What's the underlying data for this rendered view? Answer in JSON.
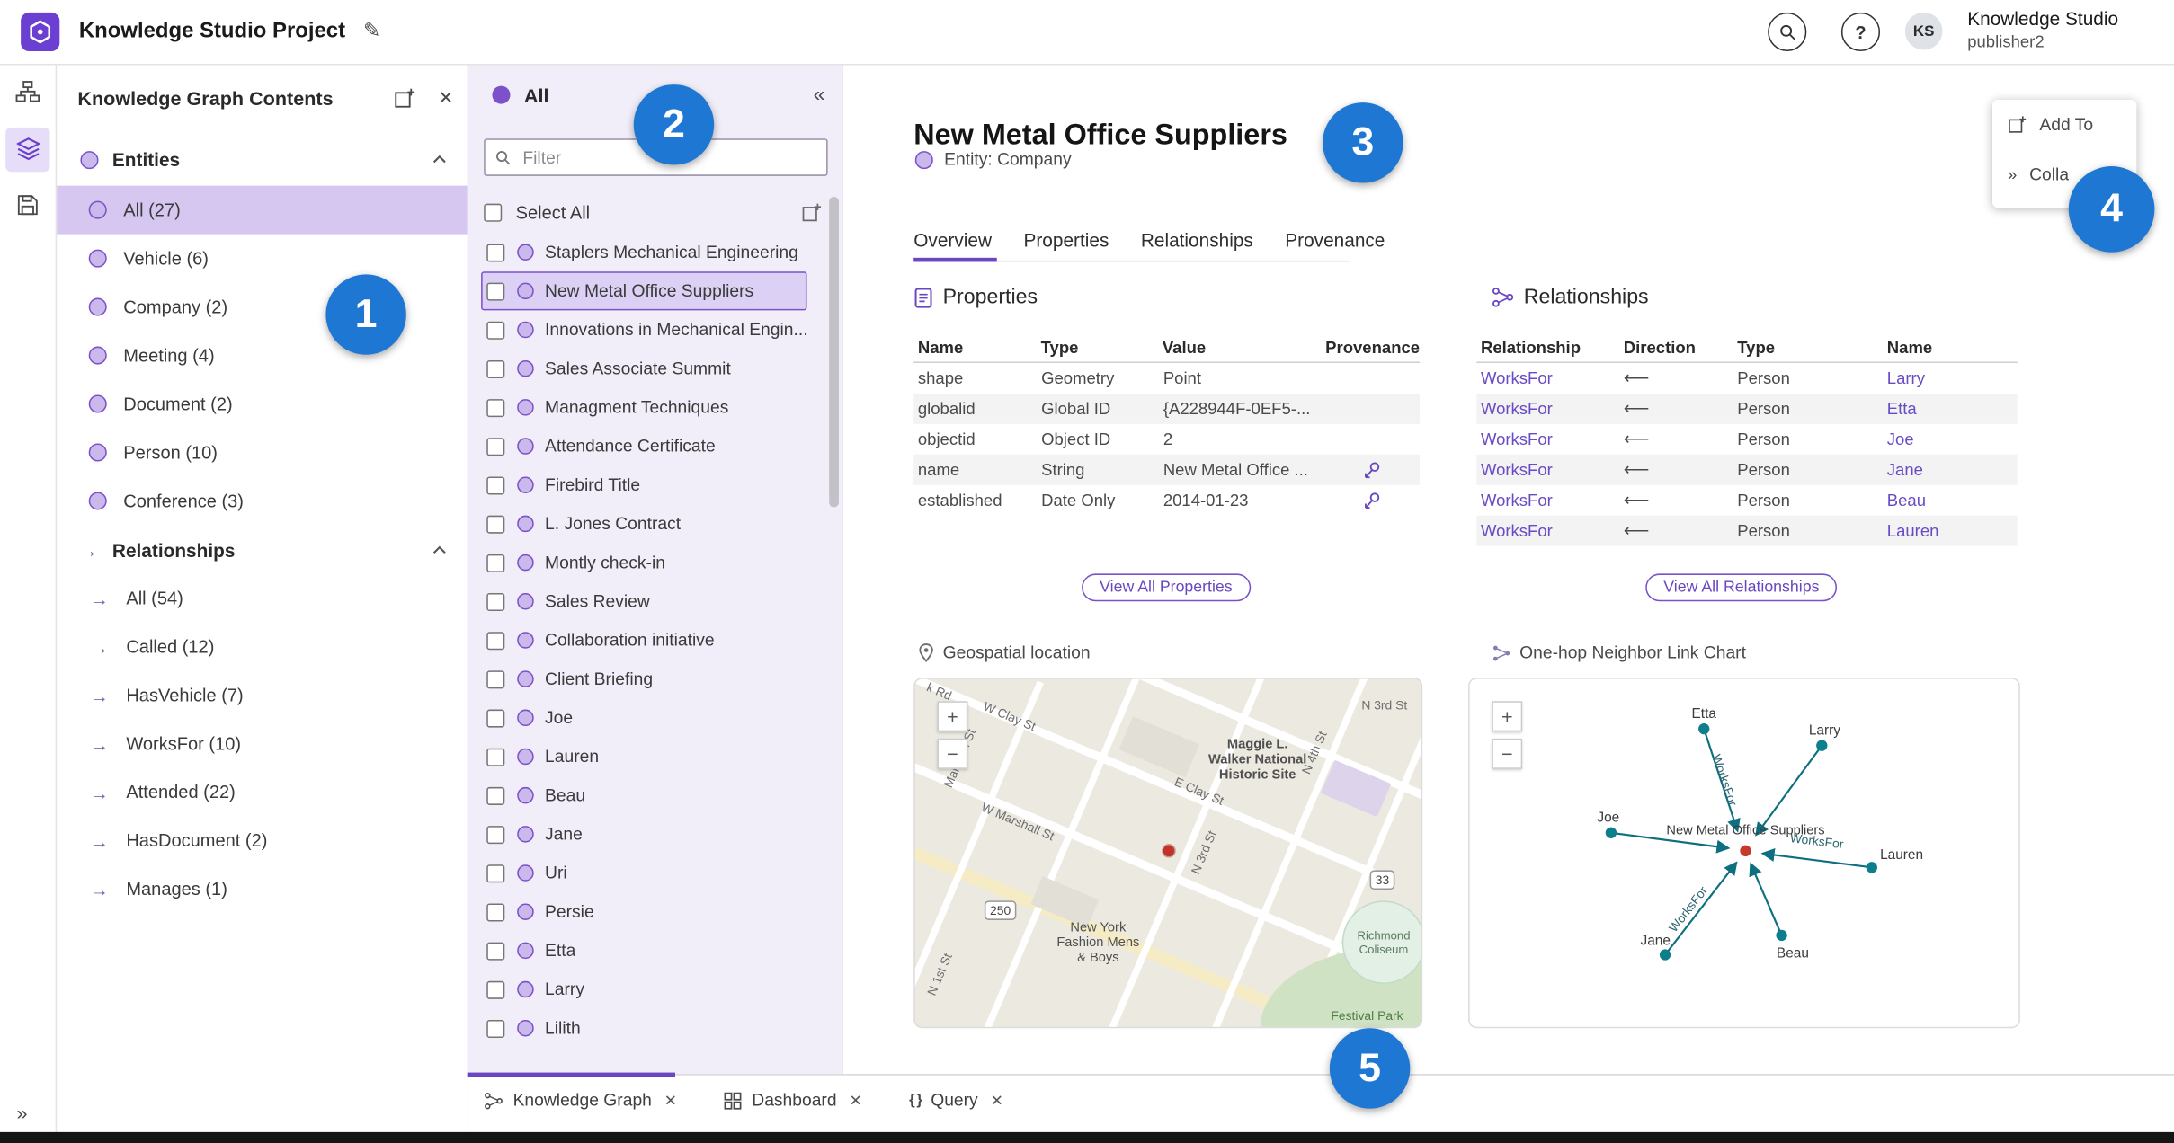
{
  "icons": {
    "close": "✕",
    "collapse_left": "«",
    "expand_rail": "»",
    "edit": "✎",
    "plus": "+",
    "minus": "−",
    "question": "?",
    "braces": "{ }",
    "chevrons_right": "»"
  },
  "topbar": {
    "title": "Knowledge Studio Project",
    "user": {
      "initials": "KS",
      "name": "Knowledge Studio",
      "role": "publisher2"
    }
  },
  "contents_panel": {
    "title": "Knowledge Graph Contents",
    "entities": {
      "label": "Entities",
      "items": [
        {
          "label": "All (27)"
        },
        {
          "label": "Vehicle (6)"
        },
        {
          "label": "Company (2)"
        },
        {
          "label": "Meeting (4)"
        },
        {
          "label": "Document (2)"
        },
        {
          "label": "Person (10)"
        },
        {
          "label": "Conference (3)"
        }
      ]
    },
    "relationships": {
      "label": "Relationships",
      "items": [
        {
          "label": "All (54)"
        },
        {
          "label": "Called (12)"
        },
        {
          "label": "HasVehicle (7)"
        },
        {
          "label": "WorksFor (10)"
        },
        {
          "label": "Attended (22)"
        },
        {
          "label": "HasDocument (2)"
        },
        {
          "label": "Manages (1)"
        }
      ]
    }
  },
  "list_panel": {
    "header": "All",
    "filter_placeholder": "Filter",
    "select_all": "Select All",
    "items": [
      {
        "label": "Staplers Mechanical Engineering"
      },
      {
        "label": "New Metal Office Suppliers"
      },
      {
        "label": "Innovations in Mechanical Engin..."
      },
      {
        "label": "Sales Associate Summit"
      },
      {
        "label": "Managment Techniques"
      },
      {
        "label": "Attendance Certificate"
      },
      {
        "label": "Firebird Title"
      },
      {
        "label": "L. Jones Contract"
      },
      {
        "label": "Montly check-in"
      },
      {
        "label": "Sales Review"
      },
      {
        "label": "Collaboration initiative"
      },
      {
        "label": "Client Briefing"
      },
      {
        "label": "Joe"
      },
      {
        "label": "Lauren"
      },
      {
        "label": "Beau"
      },
      {
        "label": "Jane"
      },
      {
        "label": "Uri"
      },
      {
        "label": "Persie"
      },
      {
        "label": "Etta"
      },
      {
        "label": "Larry"
      },
      {
        "label": "Lilith"
      }
    ]
  },
  "detail": {
    "title": "New Metal Office Suppliers",
    "entity_badge": "Entity: Company",
    "tabs": [
      {
        "label": "Overview"
      },
      {
        "label": "Properties"
      },
      {
        "label": "Relationships"
      },
      {
        "label": "Provenance"
      }
    ],
    "floating_menu": {
      "add_to": "Add To",
      "collapse": "Colla"
    },
    "properties": {
      "heading": "Properties",
      "columns": [
        "Name",
        "Type",
        "Value",
        "Provenance"
      ],
      "rows": [
        {
          "name": "shape",
          "type": "Geometry",
          "value": "Point"
        },
        {
          "name": "globalid",
          "type": "Global ID",
          "value": "{A228944F-0EF5-..."
        },
        {
          "name": "objectid",
          "type": "Object ID",
          "value": "2"
        },
        {
          "name": "name",
          "type": "String",
          "value": "New Metal Office ..."
        },
        {
          "name": "established",
          "type": "Date Only",
          "value": "2014-01-23"
        }
      ],
      "view_all": "View All Properties"
    },
    "relationships": {
      "heading": "Relationships",
      "columns": [
        "Relationship",
        "Direction",
        "Type",
        "Name"
      ],
      "rows": [
        {
          "relationship": "WorksFor",
          "direction": "⟵",
          "type": "Person",
          "name": "Larry"
        },
        {
          "relationship": "WorksFor",
          "direction": "⟵",
          "type": "Person",
          "name": "Etta"
        },
        {
          "relationship": "WorksFor",
          "direction": "⟵",
          "type": "Person",
          "name": "Joe"
        },
        {
          "relationship": "WorksFor",
          "direction": "⟵",
          "type": "Person",
          "name": "Jane"
        },
        {
          "relationship": "WorksFor",
          "direction": "⟵",
          "type": "Person",
          "name": "Beau"
        },
        {
          "relationship": "WorksFor",
          "direction": "⟵",
          "type": "Person",
          "name": "Lauren"
        }
      ],
      "view_all": "View All Relationships"
    },
    "map": {
      "heading": "Geospatial location",
      "labels": {
        "k_rd": "k Rd",
        "w_clay": "W Clay St",
        "e_clay": "E Clay St",
        "w_marshall": "W Marshall St",
        "marshall": "Marshall St",
        "n_4th": "N 4th St",
        "n_3rd_top": "N 3rd St",
        "n_3rd": "N 3rd St",
        "n_1st": "N 1st St",
        "maggie": "Maggie L.\nWalker National\nHistoric Site",
        "ny_fashion": "New York\nFashion Mens\n& Boys",
        "coliseum": "Richmond\nColiseum",
        "festival": "Festival Park"
      },
      "shields": {
        "s250": "250",
        "s33": "33"
      }
    },
    "link_chart": {
      "heading": "One-hop Neighbor Link Chart",
      "center_label": "New Metal Office Suppliers",
      "edge_label": "WorksFor",
      "nodes": [
        {
          "label": "Etta"
        },
        {
          "label": "Larry"
        },
        {
          "label": "Joe"
        },
        {
          "label": "Lauren"
        },
        {
          "label": "Jane"
        },
        {
          "label": "Beau"
        }
      ]
    }
  },
  "bottom_tabs": [
    {
      "label": "Knowledge Graph"
    },
    {
      "label": "Dashboard"
    },
    {
      "label": "Query"
    }
  ],
  "callouts": [
    {
      "n": "1"
    },
    {
      "n": "2"
    },
    {
      "n": "3"
    },
    {
      "n": "4"
    },
    {
      "n": "5"
    }
  ]
}
